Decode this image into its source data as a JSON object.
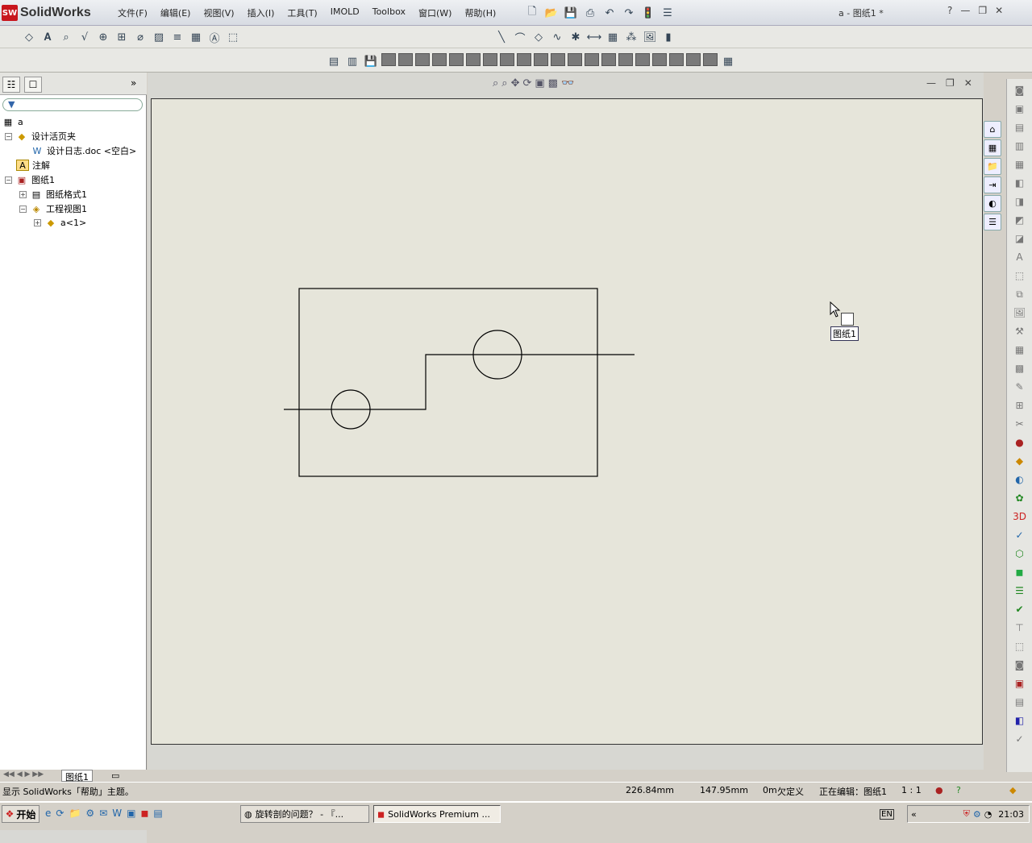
{
  "app": {
    "logo": "SW",
    "name": "SolidWorks",
    "title": "a - 图纸1 *"
  },
  "menus": [
    "文件(F)",
    "编辑(E)",
    "视图(V)",
    "插入(I)",
    "工具(T)",
    "IMOLD",
    "Toolbox",
    "窗口(W)",
    "帮助(H)"
  ],
  "window_buttons": [
    "?",
    "—",
    "❐",
    "✕"
  ],
  "feature_tree": {
    "root": "a",
    "items": [
      {
        "label": "设计活页夹",
        "icon": "binder-icon",
        "level": 1,
        "toggle": "−"
      },
      {
        "label": "设计日志.doc <空白>",
        "icon": "word-doc-icon",
        "level": 2,
        "toggle": ""
      },
      {
        "label": "注解",
        "icon": "annotation-icon",
        "level": 1,
        "toggle": ""
      },
      {
        "label": "图纸1",
        "icon": "sheet-icon",
        "level": 1,
        "toggle": "−"
      },
      {
        "label": "图纸格式1",
        "icon": "sheet-format-icon",
        "level": 2,
        "toggle": "+"
      },
      {
        "label": "工程视图1",
        "icon": "drawing-view-icon",
        "level": 2,
        "toggle": "−"
      },
      {
        "label": "a<1>",
        "icon": "part-icon",
        "level": 3,
        "toggle": "+"
      }
    ]
  },
  "sheet_tab": "图纸1",
  "cursor_tooltip": "图纸1",
  "status": {
    "message": "显示 SolidWorks「帮助」主题。",
    "x": "226.84mm",
    "y": "147.95mm",
    "z": "0m",
    "definition": "欠定义",
    "editing": "正在编辑：图纸1",
    "scale": "1 : 1"
  },
  "taskbar": {
    "start": "开始",
    "tasks": [
      "旋转剖的问题？ - 『...",
      "SolidWorks Premium ..."
    ],
    "lang": "EN",
    "time": "21:03"
  }
}
